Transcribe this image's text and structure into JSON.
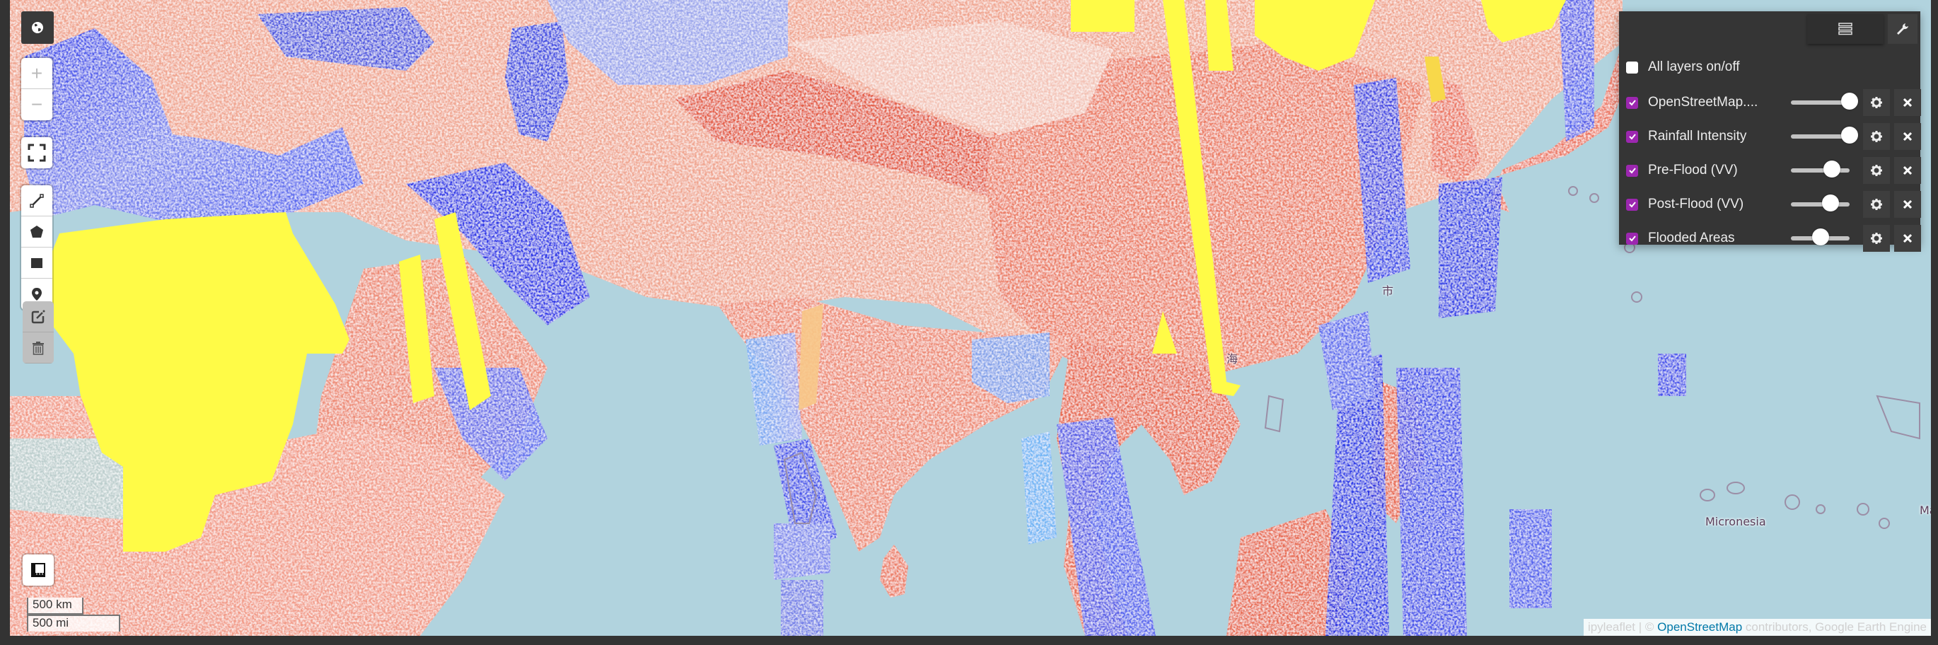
{
  "map": {
    "basemap": "OpenStreetMap",
    "colors": {
      "ocean": "#b1d3de",
      "red_high": "#e8553e",
      "red_mid": "#f2a08a",
      "blue_high": "#1a1ee8",
      "blue_mid": "#6f7fec",
      "light_blue": "#5ab4f5",
      "flood_yellow": "#fff84a",
      "panel_bg": "#353535",
      "checkbox_accent": "#9c27b0"
    },
    "labels": [
      {
        "name": "micronesia-label",
        "text": "Micronesia"
      },
      {
        "name": "marshall-label",
        "text": "Ma"
      },
      {
        "name": "hainan-label",
        "text": "海"
      },
      {
        "name": "city-label",
        "text": "市"
      }
    ]
  },
  "controls": {
    "basemap_icon": "globe-icon",
    "zoom_in": "+",
    "zoom_out": "−",
    "fullscreen_icon": "fullscreen-icon",
    "draw_tools": [
      "polyline-icon",
      "polygon-icon",
      "rectangle-icon",
      "marker-icon"
    ],
    "edit_tools": [
      "edit-icon",
      "trash-icon"
    ],
    "measure_icon": "measure-icon"
  },
  "scale": {
    "metric": "500 km",
    "imperial": "500 mi"
  },
  "attribution": {
    "prefix": "ipyleaflet | © ",
    "link": "OpenStreetMap",
    "suffix": " contributors, Google Earth Engine"
  },
  "layer_panel": {
    "toggle_icon": "layers-icon",
    "settings_icon": "wrench-icon",
    "all_layers": {
      "label": "All layers on/off",
      "checked": false
    },
    "layers": [
      {
        "label": "OpenStreetMap....",
        "checked": true,
        "opacity": 1.0
      },
      {
        "label": "Rainfall Intensity",
        "checked": true,
        "opacity": 1.0
      },
      {
        "label": "Pre-Flood (VV)",
        "checked": true,
        "opacity": 0.7
      },
      {
        "label": "Post-Flood (VV)",
        "checked": true,
        "opacity": 0.67
      },
      {
        "label": "Flooded Areas",
        "checked": true,
        "opacity": 0.5
      }
    ]
  }
}
